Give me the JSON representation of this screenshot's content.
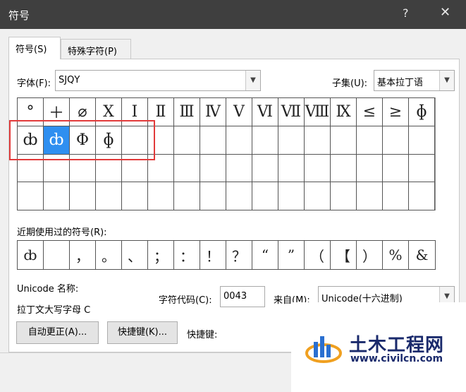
{
  "window": {
    "title": "符号",
    "help": "?",
    "close": "✕"
  },
  "tabs": [
    {
      "label": "符号(S)",
      "active": true
    },
    {
      "label": "特殊字符(P)",
      "active": false
    }
  ],
  "font": {
    "label": "字体(F):",
    "value": "SJQY"
  },
  "subset": {
    "label": "子集(U):",
    "value": "基本拉丁语"
  },
  "symbol_grid": {
    "rows": [
      [
        "°",
        "＋",
        "⌀",
        "Ⅹ",
        "Ⅰ",
        "Ⅱ",
        "Ⅲ",
        "Ⅳ",
        "Ⅴ",
        "Ⅵ",
        "Ⅶ",
        "Ⅷ",
        "Ⅸ",
        "≤",
        "≥",
        "ɸ"
      ],
      [
        "ȸ",
        "ȸ",
        "Φ",
        "ɸ",
        "",
        "",
        "",
        "",
        "",
        "",
        "",
        "",
        "",
        "",
        "",
        ""
      ],
      [
        "",
        "",
        "",
        "",
        "",
        "",
        "",
        "",
        "",
        "",
        "",
        "",
        "",
        "",
        "",
        ""
      ],
      [
        "",
        "",
        "",
        "",
        "",
        "",
        "",
        "",
        "",
        "",
        "",
        "",
        "",
        "",
        "",
        ""
      ]
    ],
    "selected": {
      "row": 1,
      "col": 1
    }
  },
  "recent": {
    "label": "近期使用过的符号(R):",
    "symbols": [
      "ȸ",
      "",
      "，",
      "。",
      "、",
      "；",
      "：",
      "！",
      "？",
      "“",
      "”",
      "（",
      "【",
      "）",
      "%",
      "&"
    ]
  },
  "unicode": {
    "name_label": "Unicode 名称:",
    "name_value": "拉丁文大写字母 C"
  },
  "char_code": {
    "label": "字符代码(C):",
    "value": "0043"
  },
  "from": {
    "label": "来自(M):",
    "value": "Unicode(十六进制)"
  },
  "buttons": {
    "autocorrect": "自动更正(A)...",
    "shortcut_key": "快捷键(K)..."
  },
  "shortcut_label": "快捷键:",
  "watermark": {
    "brand": "土木工程网",
    "url": "www.civilcn.com"
  },
  "colors": {
    "titlebar": "#3f3f3f",
    "selection": "#2f8ff0",
    "highlight_box": "#e23a3a"
  }
}
